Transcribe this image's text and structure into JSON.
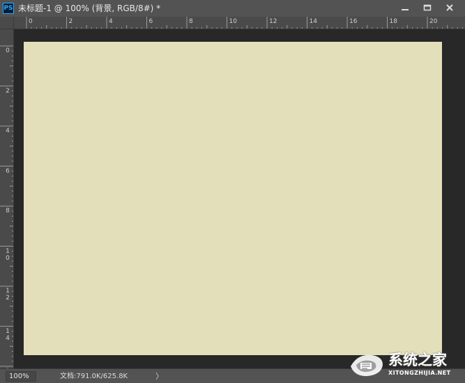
{
  "window": {
    "app_icon": "PS",
    "title": "未标题-1 @ 100% (背景, RGB/8#) *",
    "controls": [
      "minimize-icon",
      "maximize-icon",
      "close-icon"
    ]
  },
  "rulers": {
    "top_labels": [
      "0",
      "2",
      "4",
      "6",
      "8",
      "10",
      "12",
      "14",
      "16",
      "18",
      "20"
    ],
    "left_labels": [
      "0",
      "2",
      "4",
      "6",
      "8",
      "1\n0",
      "1\n2",
      "1\n4",
      "1\n"
    ]
  },
  "canvas": {
    "background_color": "#e3dfbb",
    "pasteboard_color": "#282828"
  },
  "status": {
    "zoom": "100%",
    "doc_info": "文档:791.0K/625.8K",
    "menu_arrow": "〉"
  },
  "watermark": {
    "text": "系统之家",
    "subtext": "XITONGZHIJIA.NET"
  }
}
